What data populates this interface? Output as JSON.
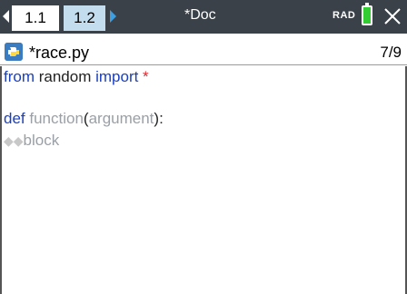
{
  "topbar": {
    "tab_active": "1.1",
    "tab_inactive": "1.2",
    "doc_title": "*Doc",
    "angle_mode": "RAD"
  },
  "file": {
    "name": "*race.py",
    "position": "7/9"
  },
  "code": {
    "line1": {
      "kw_from": "from",
      "module": " random ",
      "kw_import": "import",
      "star": " *"
    },
    "line3": {
      "kw_def": "def",
      "name": " function",
      "paren_open": "(",
      "arg": "argument",
      "paren_close": "):"
    },
    "line4": {
      "dots": "◆◆",
      "block": "block"
    }
  },
  "colors": {
    "topbar": "#3b4149",
    "active_tab": "#ffffff",
    "inactive_tab": "#c3dcee",
    "keyword": "#1a3fbf",
    "battery": "#33cc33"
  }
}
